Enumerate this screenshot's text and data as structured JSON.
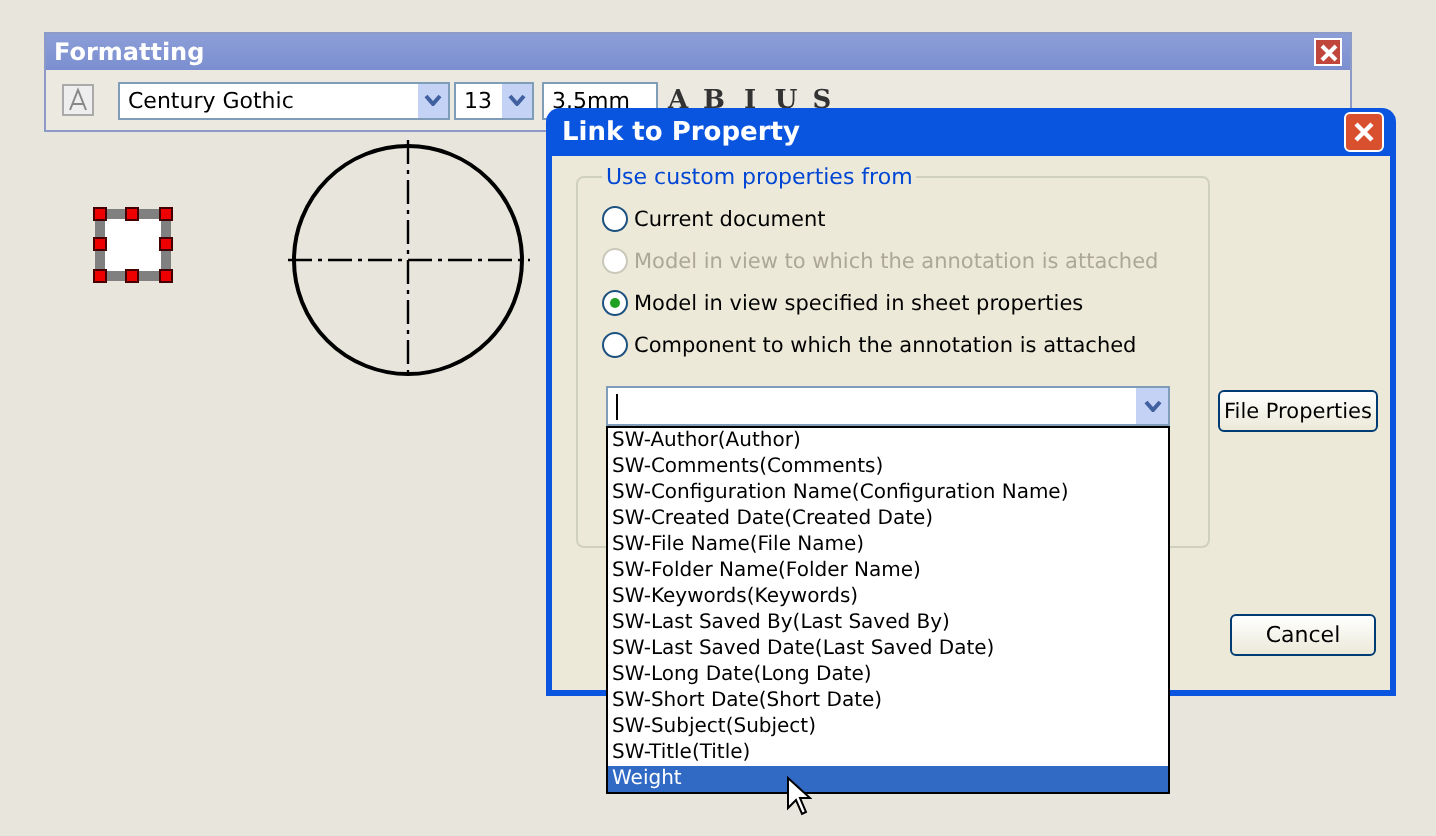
{
  "formatting_toolbar": {
    "title": "Formatting",
    "font": "Century Gothic",
    "size": "13",
    "height": "3.5mm",
    "style_buttons": [
      "A",
      "B",
      "I",
      "U",
      "S"
    ]
  },
  "dialog": {
    "title": "Link to Property",
    "group_title": "Use custom properties from",
    "options": [
      {
        "label": "Current document",
        "selected": false,
        "disabled": false
      },
      {
        "label": "Model in view to which the annotation is attached",
        "selected": false,
        "disabled": true
      },
      {
        "label": "Model in view specified in sheet properties",
        "selected": true,
        "disabled": false
      },
      {
        "label": "Component to which the annotation is attached",
        "selected": false,
        "disabled": false
      }
    ],
    "file_properties_button": "File Properties",
    "dropdown_items": [
      {
        "label": "SW-Author(Author)",
        "selected": false
      },
      {
        "label": "SW-Comments(Comments)",
        "selected": false
      },
      {
        "label": "SW-Configuration Name(Configuration Name)",
        "selected": false
      },
      {
        "label": "SW-Created Date(Created Date)",
        "selected": false
      },
      {
        "label": "SW-File Name(File Name)",
        "selected": false
      },
      {
        "label": "SW-Folder Name(Folder Name)",
        "selected": false
      },
      {
        "label": "SW-Keywords(Keywords)",
        "selected": false
      },
      {
        "label": "SW-Last Saved By(Last Saved By)",
        "selected": false
      },
      {
        "label": "SW-Last Saved Date(Last Saved Date)",
        "selected": false
      },
      {
        "label": "SW-Long Date(Long Date)",
        "selected": false
      },
      {
        "label": "SW-Short Date(Short Date)",
        "selected": false
      },
      {
        "label": "SW-Subject(Subject)",
        "selected": false
      },
      {
        "label": "SW-Title(Title)",
        "selected": false
      },
      {
        "label": "Weight",
        "selected": true
      }
    ],
    "cancel_button": "Cancel"
  }
}
